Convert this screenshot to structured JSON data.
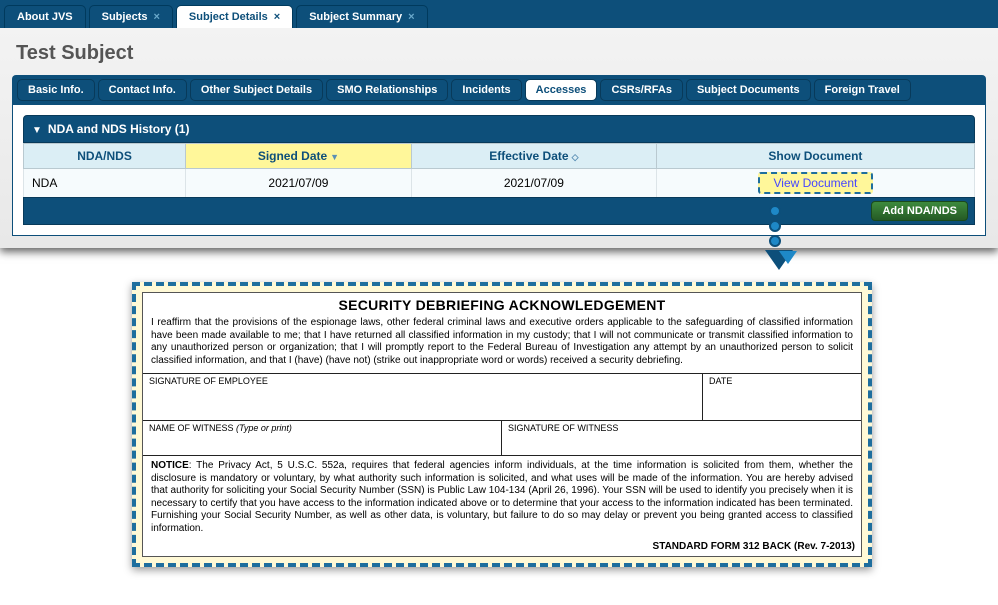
{
  "top_tabs": {
    "about": "About JVS",
    "subjects": "Subjects",
    "subject_details": "Subject Details",
    "subject_summary": "Subject Summary"
  },
  "page_title": "Test Subject",
  "sub_tabs": {
    "basic": "Basic Info.",
    "contact": "Contact Info.",
    "other": "Other Subject Details",
    "smo": "SMO Relationships",
    "incidents": "Incidents",
    "accesses": "Accesses",
    "csrs": "CSRs/RFAs",
    "docs": "Subject Documents",
    "travel": "Foreign Travel"
  },
  "accordion_title": "NDA and NDS History (1)",
  "table": {
    "headers": {
      "col1": "NDA/NDS",
      "col2": "Signed Date",
      "col3": "Effective Date",
      "col4": "Show Document"
    },
    "row": {
      "type": "NDA",
      "signed": "2021/07/09",
      "effective": "2021/07/09",
      "view": "View Document"
    },
    "add_btn": "Add NDA/NDS"
  },
  "close_x": "×",
  "doc": {
    "title": "SECURITY DEBRIEFING ACKNOWLEDGEMENT",
    "para": "I reaffirm that the provisions of the espionage laws, other federal criminal laws and executive orders applicable to the safeguarding of classified information have been made available to me; that I have returned all classified information in my custody; that I will not communicate or transmit classified information to any unauthorized person or organization; that I will promptly report to the Federal Bureau of Investigation any attempt by an unauthorized person to solicit classified information, and that I (have) (have not) (strike out inappropriate word or words) received a security debriefing.",
    "sig_emp": "SIGNATURE OF EMPLOYEE",
    "date": "DATE",
    "wit_name": "NAME OF WITNESS",
    "wit_name_hint": "(Type or print)",
    "wit_sig": "SIGNATURE OF WITNESS",
    "notice_label": "NOTICE",
    "notice": ": The Privacy Act, 5 U.S.C. 552a, requires that federal agencies inform individuals, at the time information is solicited from them, whether the disclosure is mandatory or voluntary, by what authority such information is solicited, and what uses will be made of the information. You are hereby advised that authority for soliciting your Social Security Number (SSN) is Public Law 104-134 (April 26, 1996). Your SSN will be used to identify you precisely when it is necessary to certify that you have access to the information indicated above or to determine that your access to the information indicated has been terminated. Furnishing your Social Security Number, as well as other data, is voluntary, but failure to do so may delay or prevent you being granted access to classified information.",
    "form_footer": "STANDARD FORM 312 BACK (Rev. 7-2013)"
  }
}
